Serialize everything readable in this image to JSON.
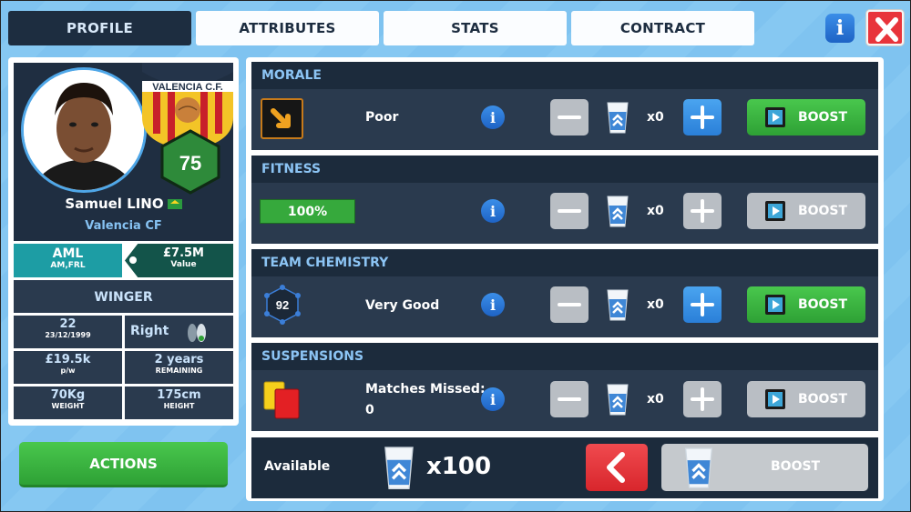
{
  "tabs": [
    {
      "label": "PROFILE",
      "active": true
    },
    {
      "label": "ATTRIBUTES",
      "active": false
    },
    {
      "label": "STATS",
      "active": false
    },
    {
      "label": "CONTRACT",
      "active": false
    }
  ],
  "top_buttons": {
    "info_icon": "info-icon",
    "close_icon": "close-icon"
  },
  "player": {
    "name": "Samuel LINO",
    "club": "Valencia CF",
    "crest_text": "VALENCIA C.F.",
    "rating": "75",
    "position": "AML",
    "alt_positions": "AM,FRL",
    "value": "£7.5M",
    "value_label": "Value",
    "role": "WINGER",
    "age": "22",
    "dob": "23/12/1999",
    "foot": "Right",
    "wage": "£19.5k",
    "wage_label": "p/w",
    "contract": "2 years",
    "contract_label": "REMAINING",
    "weight": "70Kg",
    "weight_label": "WEIGHT",
    "height": "175cm",
    "height_label": "HEIGHT"
  },
  "actions_label": "ACTIONS",
  "sections": [
    {
      "title": "MORALE",
      "status": "Poor",
      "count": "x0",
      "plus_enabled": true,
      "boost_label": "BOOST",
      "boost_enabled": true,
      "icon": "arrow-down-right-icon"
    },
    {
      "title": "FITNESS",
      "status": "100%",
      "count": "x0",
      "plus_enabled": false,
      "boost_label": "BOOST",
      "boost_enabled": false,
      "icon": "fitness-bar"
    },
    {
      "title": "TEAM CHEMISTRY",
      "status": "Very Good",
      "chem_value": "92",
      "count": "x0",
      "plus_enabled": true,
      "boost_label": "BOOST",
      "boost_enabled": true,
      "icon": "chemistry-icon"
    },
    {
      "title": "SUSPENSIONS",
      "status": "Matches Missed:",
      "status_value": "0",
      "count": "x0",
      "plus_enabled": false,
      "boost_label": "BOOST",
      "boost_enabled": false,
      "icon": "cards-icon"
    }
  ],
  "bottom": {
    "available_label": "Available",
    "available_count": "x100",
    "boost_label": "BOOST"
  },
  "colors": {
    "accent_blue": "#2a7fd8",
    "boost_green": "#2ea135",
    "disabled_grey": "#b9bec4",
    "panel_dark": "#2a3a4e",
    "header_dark": "#1c2b3c",
    "close_red": "#e8343b"
  }
}
